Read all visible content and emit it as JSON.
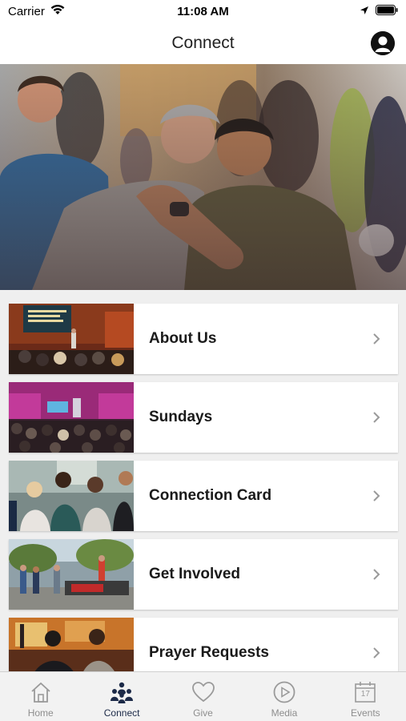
{
  "status_bar": {
    "carrier": "Carrier",
    "time": "11:08 AM"
  },
  "nav": {
    "title": "Connect"
  },
  "menu": {
    "items": [
      {
        "label": "About Us"
      },
      {
        "label": "Sundays"
      },
      {
        "label": "Connection Card"
      },
      {
        "label": "Get Involved"
      },
      {
        "label": "Prayer Requests"
      }
    ]
  },
  "tabs": [
    {
      "label": "Home",
      "icon": "home-icon"
    },
    {
      "label": "Connect",
      "icon": "people-icon",
      "active": true
    },
    {
      "label": "Give",
      "icon": "heart-icon"
    },
    {
      "label": "Media",
      "icon": "play-icon"
    },
    {
      "label": "Events",
      "icon": "calendar-icon",
      "calendar_day": "17"
    }
  ],
  "colors": {
    "active_tab": "#1c2a48",
    "inactive_tab": "#8e8e8e",
    "card_bg": "#ffffff",
    "page_bg": "#efefef"
  }
}
